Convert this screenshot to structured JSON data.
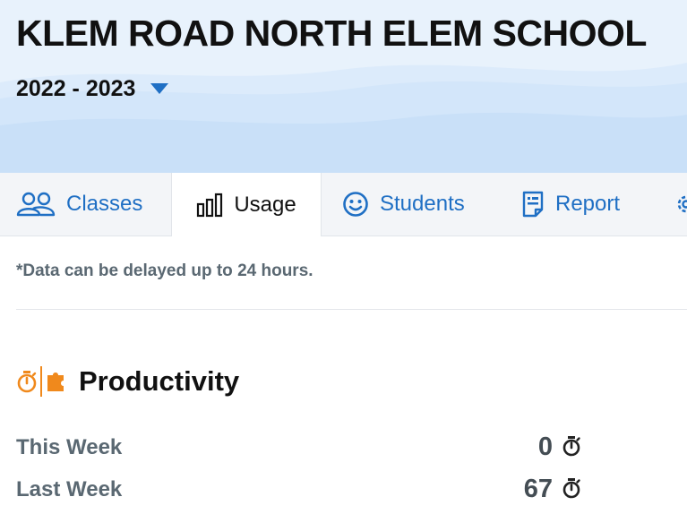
{
  "header": {
    "school_name": "KLEM ROAD NORTH ELEM SCHOOL",
    "school_year": "2022 - 2023",
    "year_dropdown_icon": "caret-down-icon"
  },
  "tabs": [
    {
      "label": "Classes",
      "icon": "people-icon",
      "active": false
    },
    {
      "label": "Usage",
      "icon": "bar-chart-icon",
      "active": true
    },
    {
      "label": "Students",
      "icon": "smiley-icon",
      "active": false
    },
    {
      "label": "Report",
      "icon": "report-icon",
      "active": false
    },
    {
      "label": "",
      "icon": "gear-icon",
      "active": false
    }
  ],
  "notice": "*Data can be delayed up to 24 hours.",
  "productivity": {
    "title": "Productivity",
    "icons": [
      "stopwatch-icon",
      "puzzle-icon"
    ],
    "rows": [
      {
        "label": "This Week",
        "value": "0",
        "icon": "stopwatch-icon"
      },
      {
        "label": "Last Week",
        "value": "67",
        "icon": "stopwatch-icon"
      }
    ]
  },
  "colors": {
    "hero_background": "#dcebfb",
    "tab_link": "#1f6fc4",
    "accent_orange": "#f0891c",
    "label_gray": "#5a6872"
  }
}
